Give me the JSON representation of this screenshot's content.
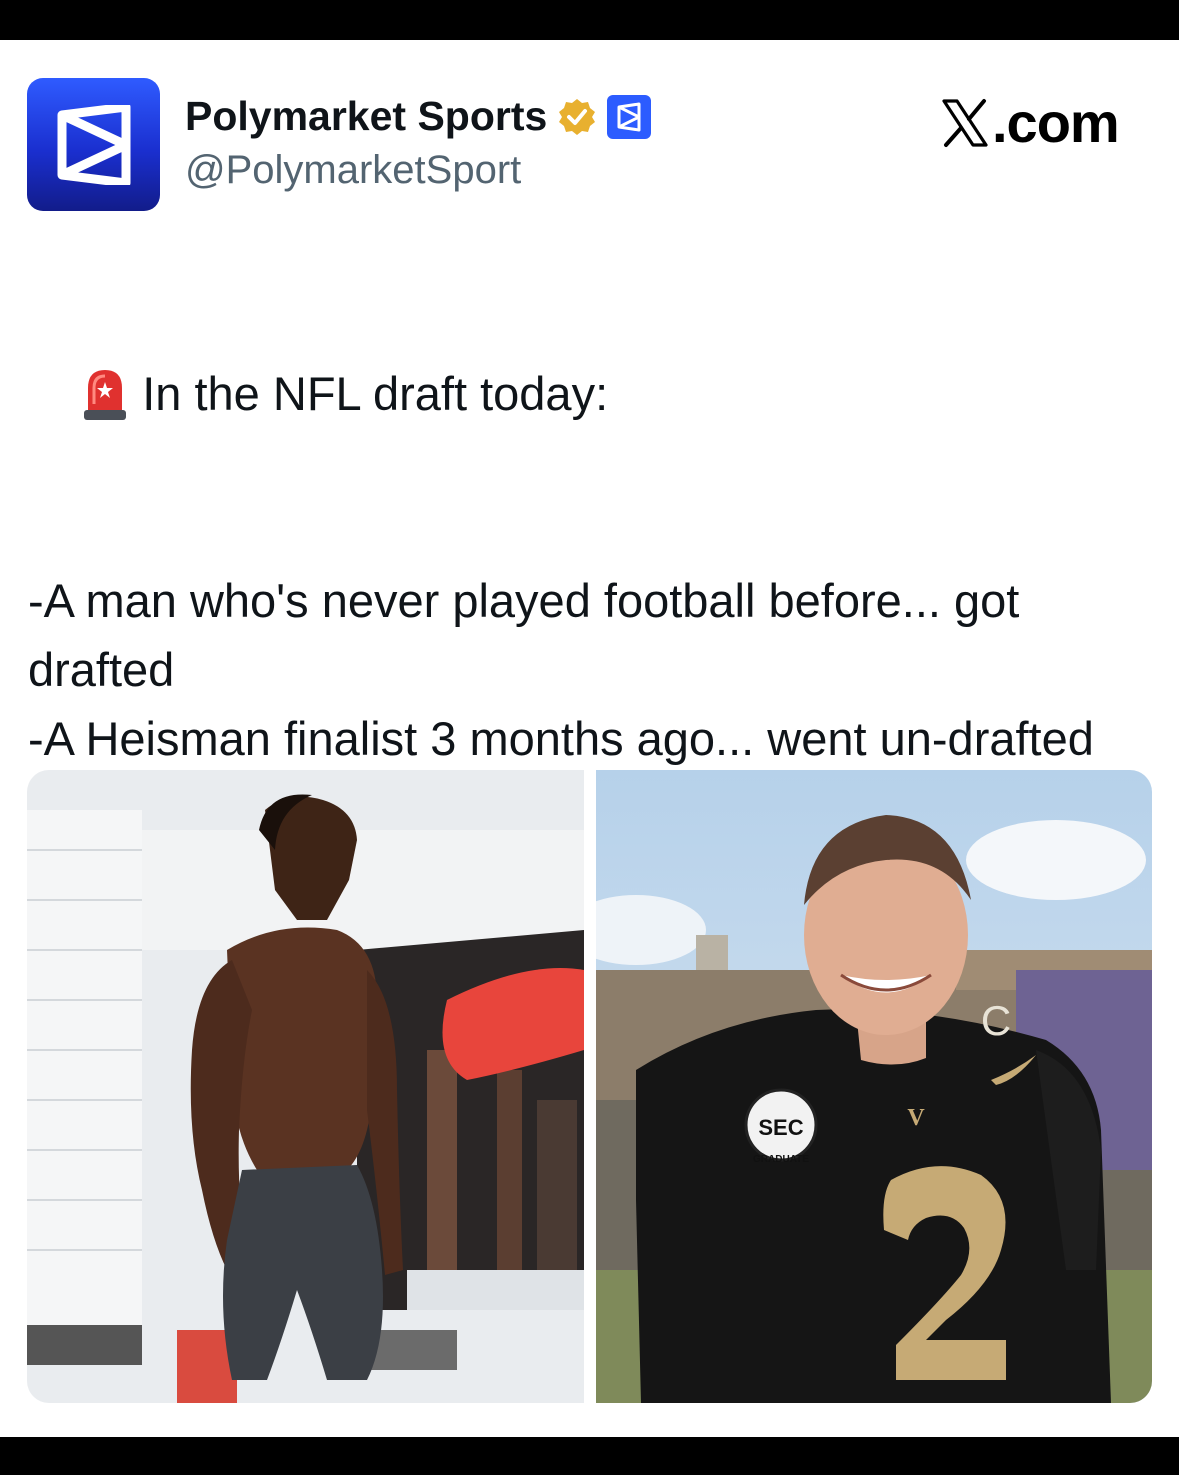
{
  "account": {
    "display_name": "Polymarket Sports",
    "handle": "@PolymarketSport",
    "verified": true
  },
  "site": {
    "label": ".com",
    "logo": "x-logo-icon"
  },
  "tweet": {
    "headline": "In the NFL draft today:",
    "lines": [
      "-A man who's never played football before... got drafted",
      "-A Heisman finalist 3 months ago... went un-drafted"
    ],
    "emoji": "siren-icon"
  },
  "media": {
    "photos": [
      {
        "name": "photo-shirtless-athlete"
      },
      {
        "name": "photo-football-player-number-2",
        "jersey_number": "2",
        "patch_text": "SEC",
        "patch_sub": "GRADUATE",
        "letters": [
          "C",
          "V"
        ]
      }
    ]
  },
  "colors": {
    "brand": "#2c5cff",
    "verified_gold": "#e8b02f",
    "text": "#0f1419",
    "muted": "#536471"
  }
}
